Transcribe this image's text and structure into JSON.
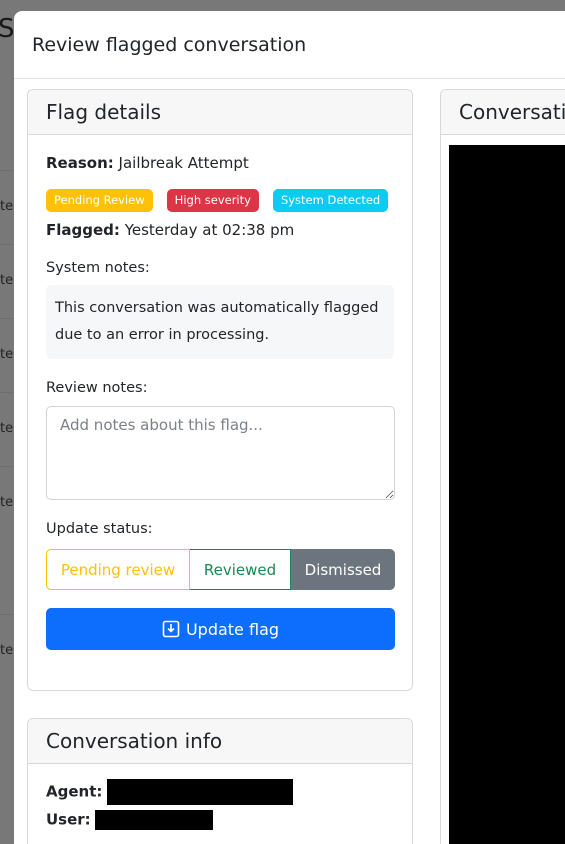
{
  "modal": {
    "title": "Review flagged conversation"
  },
  "flag_details": {
    "header": "Flag details",
    "reason_label": "Reason:",
    "reason_value": "Jailbreak Attempt",
    "badges": {
      "status": "Pending Review",
      "severity": "High severity",
      "source": "System Detected"
    },
    "flagged_label": "Flagged:",
    "flagged_value": "Yesterday at 02:38 pm",
    "system_notes_label": "System notes:",
    "system_notes_text": "This conversation was automatically flagged due to an error in processing.",
    "review_notes_label": "Review notes:",
    "review_notes_placeholder": "Add notes about this flag...",
    "update_status_label": "Update status:",
    "status_options": [
      "Pending review",
      "Reviewed",
      "Dismissed"
    ],
    "selected_status": "Dismissed",
    "update_button": "Update flag"
  },
  "conversation_info": {
    "header": "Conversation info",
    "agent_label": "Agent:",
    "user_label": "User:"
  },
  "conversation": {
    "header": "Conversation"
  },
  "background": {
    "title_fragment": "S",
    "row_fragment": "te"
  },
  "colors": {
    "primary": "#0d6efd",
    "warning": "#ffc107",
    "danger": "#dc3545",
    "info": "#0dcaf0",
    "success": "#198754",
    "secondary": "#6c757d"
  }
}
